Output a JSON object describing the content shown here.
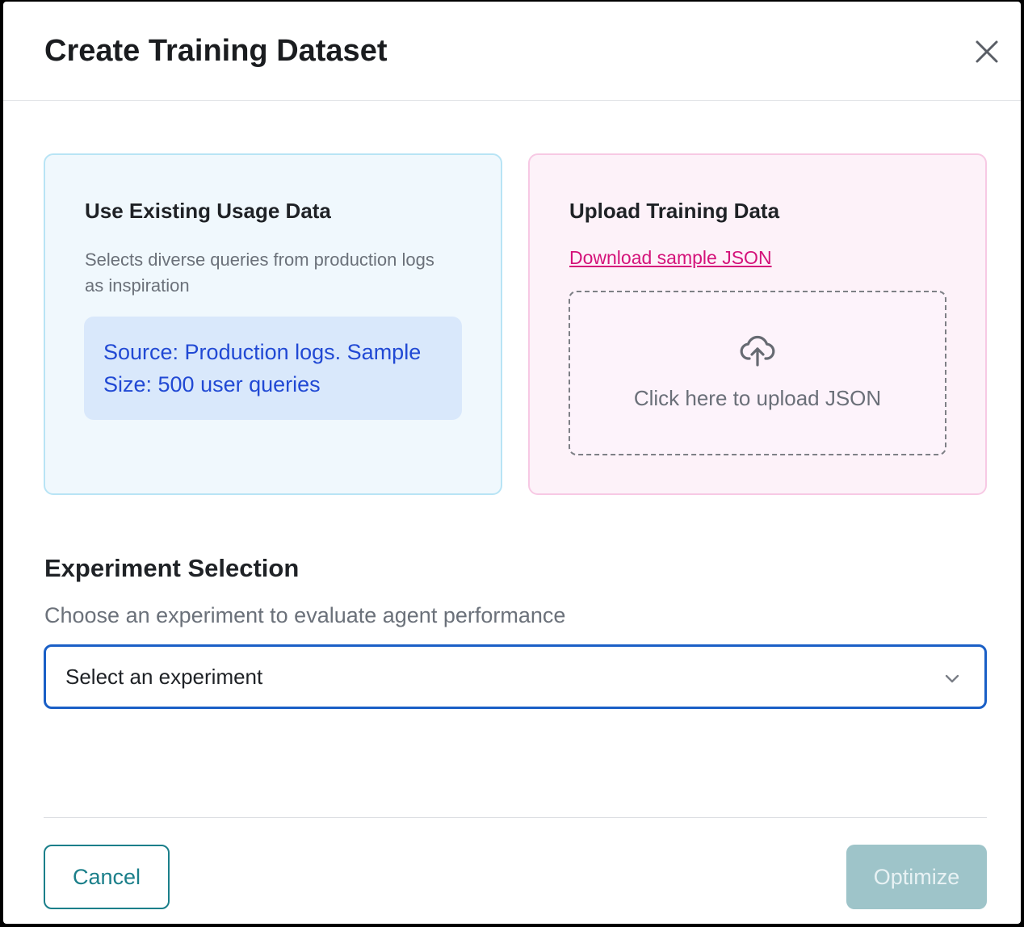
{
  "modal": {
    "title": "Create Training Dataset"
  },
  "existing_card": {
    "title": "Use Existing Usage Data",
    "description": "Selects diverse queries from production logs as inspiration",
    "source_info": "Source: Production logs. Sample Size: 500 user queries"
  },
  "upload_card": {
    "title": "Upload Training Data",
    "download_link": "Download sample JSON",
    "dropzone_text": "Click here to upload JSON",
    "icon": "cloud-upload-icon"
  },
  "experiment": {
    "title": "Experiment Selection",
    "description": "Choose an experiment to evaluate agent performance",
    "selected_value": "Select an experiment"
  },
  "footer": {
    "cancel_label": "Cancel",
    "optimize_label": "Optimize"
  },
  "colors": {
    "accent_teal": "#1b7f8a",
    "select_border": "#1a5fc6",
    "link_pink": "#d4127a",
    "source_text_blue": "#2149d4",
    "optimize_disabled": "#9ec4c9"
  }
}
